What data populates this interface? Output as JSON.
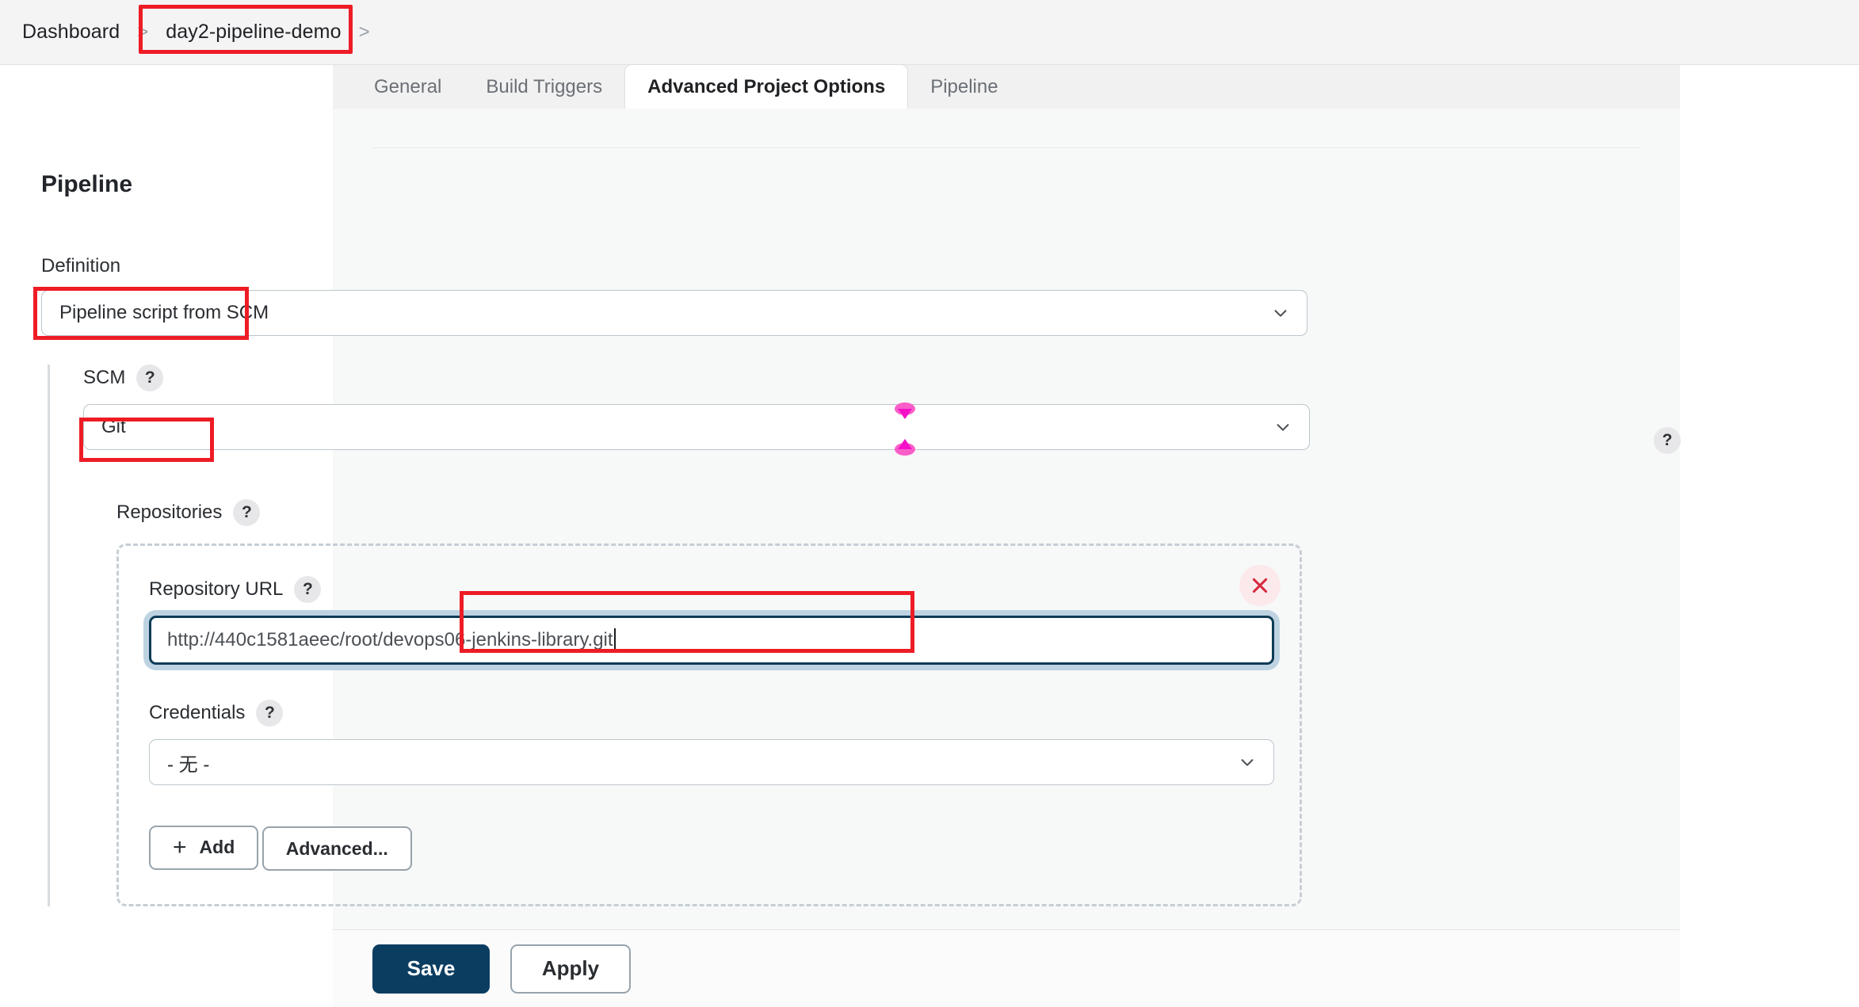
{
  "breadcrumb": {
    "items": [
      {
        "label": "Dashboard",
        "separator": ">"
      },
      {
        "label": "day2-pipeline-demo",
        "separator": ">"
      }
    ]
  },
  "tabs": [
    {
      "label": "General",
      "active": false
    },
    {
      "label": "Build Triggers",
      "active": false
    },
    {
      "label": "Advanced Project Options",
      "active": true
    },
    {
      "label": "Pipeline",
      "active": false
    }
  ],
  "main": {
    "section_title": "Pipeline",
    "definition": {
      "label": "Definition",
      "value": "Pipeline script from SCM"
    },
    "scm": {
      "label": "SCM",
      "help": "?",
      "value": "Git",
      "right_help": "?"
    },
    "repositories": {
      "label": "Repositories",
      "help": "?",
      "delete_icon": "close-icon",
      "repository_url": {
        "label": "Repository URL",
        "help": "?",
        "value": "http://440c1581aeec/root/devops06-jenkins-library.git"
      },
      "credentials": {
        "label": "Credentials",
        "help": "?",
        "value": "- 无 -"
      },
      "add_button": {
        "icon": "plus-icon",
        "label": "Add"
      },
      "advanced_button": {
        "label": "Advanced..."
      }
    }
  },
  "action_bar": {
    "save_label": "Save",
    "apply_label": "Apply"
  },
  "colors": {
    "annotation_red": "#ee1c25",
    "marker_magenta": "#f510c8",
    "save_navy": "#0b3d61",
    "focus_border": "#0d3b56",
    "focus_ring": "#bed3e2",
    "delete_red": "#d52b3f"
  }
}
